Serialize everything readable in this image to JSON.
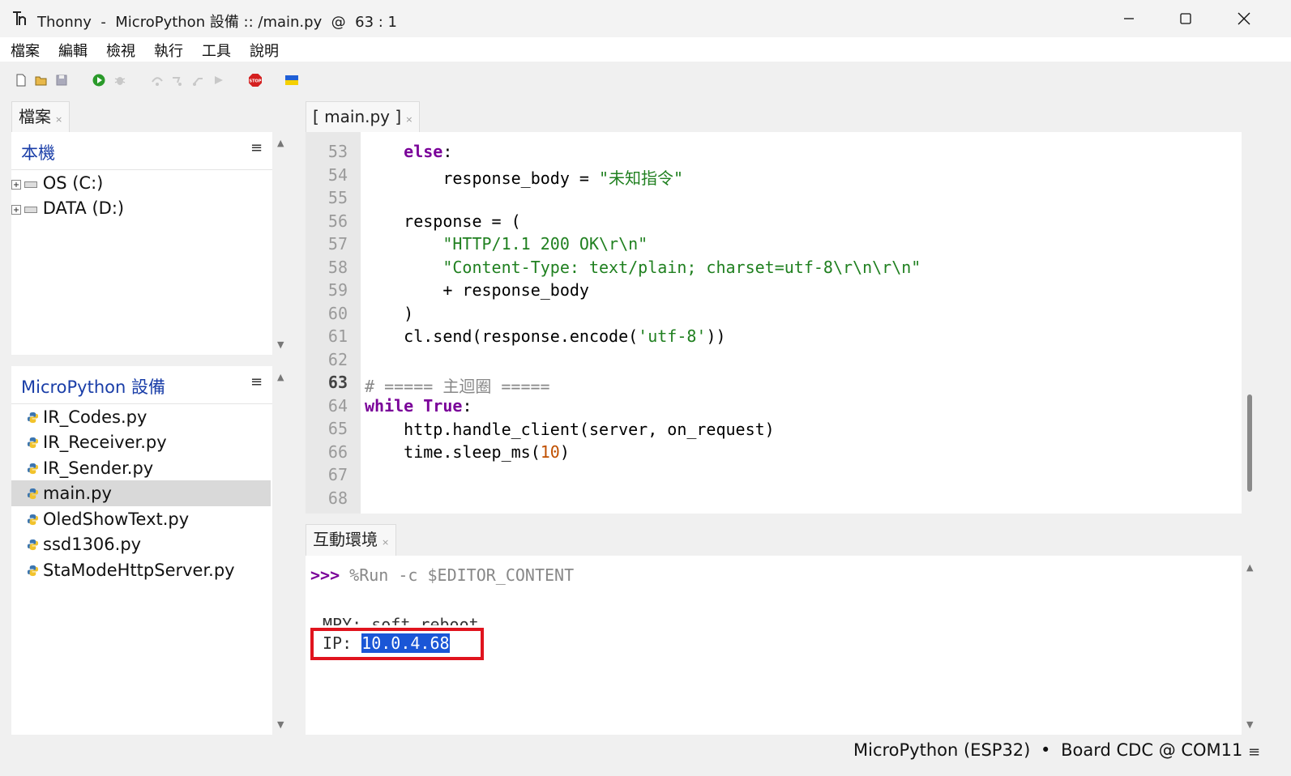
{
  "window": {
    "title": "Thonny  -  MicroPython 設備 :: /main.py  @  63 : 1"
  },
  "menu": [
    "檔案",
    "編輯",
    "檢視",
    "執行",
    "工具",
    "說明"
  ],
  "files_tab": {
    "label": "檔案"
  },
  "local": {
    "header": "本機",
    "drives": [
      "OS (C:)",
      "DATA (D:)"
    ]
  },
  "device": {
    "header": "MicroPython 設備",
    "files": [
      "IR_Codes.py",
      "IR_Receiver.py",
      "IR_Sender.py",
      "main.py",
      "OledShowText.py",
      "ssd1306.py",
      "StaModeHttpServer.py"
    ],
    "selected": "main.py"
  },
  "editor": {
    "tab_label": "[ main.py ]",
    "current_line": 63,
    "line_numbers": [
      "53",
      "54",
      "55",
      "56",
      "57",
      "58",
      "59",
      "60",
      "61",
      "62",
      "63",
      "64",
      "65",
      "66",
      "67",
      "68"
    ],
    "lines": [
      "    else:",
      "        response_body = \"未知指令\"",
      "",
      "    response = (",
      "        \"HTTP/1.1 200 OK\\r\\n\"",
      "        \"Content-Type: text/plain; charset=utf-8\\r\\n\\r\\n\"",
      "        + response_body",
      "    )",
      "    cl.send(response.encode('utf-8'))",
      "",
      "# ===== 主迴圈 =====",
      "while True:",
      "    http.handle_client(server, on_request)",
      "    time.sleep_ms(10)",
      "",
      ""
    ]
  },
  "shell": {
    "tab_label": "互動環境",
    "prompt": ">>>",
    "command": "%Run -c $EDITOR_CONTENT",
    "output1": "MPY: soft reboot",
    "ip_label": "IP: ",
    "ip_value": "10.0.4.68"
  },
  "status": {
    "interpreter": "MicroPython (ESP32)",
    "separator": "•",
    "port": "Board CDC @ COM11"
  },
  "colors": {
    "keyword": "#7a0099",
    "string": "#208020",
    "number": "#c05000",
    "highlight_box": "#e0141e",
    "selection": "#1a56d6"
  }
}
